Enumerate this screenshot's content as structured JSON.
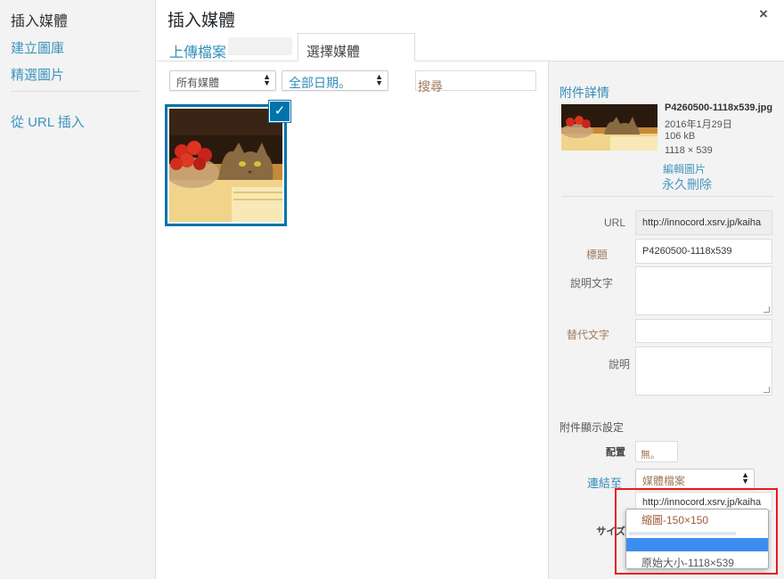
{
  "sidebar": {
    "active": "插入媒體",
    "items": [
      "建立圖庫",
      "精選圖片"
    ],
    "url_insert": "從 URL 插入"
  },
  "modal": {
    "title": "插入媒體",
    "close_glyph": "×",
    "tabs": {
      "upload": "上傳檔案",
      "select": "選擇媒體"
    }
  },
  "toolbar": {
    "media_filter": "所有媒體",
    "date_filter": "全部日期。",
    "search_placeholder": "搜尋"
  },
  "attachment": {
    "section_title": "附件詳情",
    "filename": "P4260500-1118x539.jpg",
    "date": "2016年1月29日",
    "filesize": "106 kB",
    "dimensions": "1118 × 539",
    "edit_link": "編輯圖片",
    "delete_link": "永久刪除",
    "fields": {
      "url_label": "URL",
      "url_value": "http://innocord.xsrv.jp/kaiha",
      "title_label": "標題",
      "title_value": "P4260500-1118x539",
      "caption_label": "說明文字",
      "alt_label": "替代文字",
      "desc_label": "說明"
    }
  },
  "display_settings": {
    "heading": "附件顯示設定",
    "align_label": "配置",
    "align_value": "無。",
    "link_label": "連結至",
    "link_value": "媒體檔案",
    "link_url": "http://innocord.xsrv.jp/kaiha",
    "size_label": "サイズ",
    "size_options": [
      "縮圖-150×150",
      "",
      "原始大小-1118×539"
    ],
    "highlighted_index": 1
  },
  "colors": {
    "accent": "#0073aa",
    "highlight": "#3c8df0",
    "annotation": "#e8191c"
  }
}
